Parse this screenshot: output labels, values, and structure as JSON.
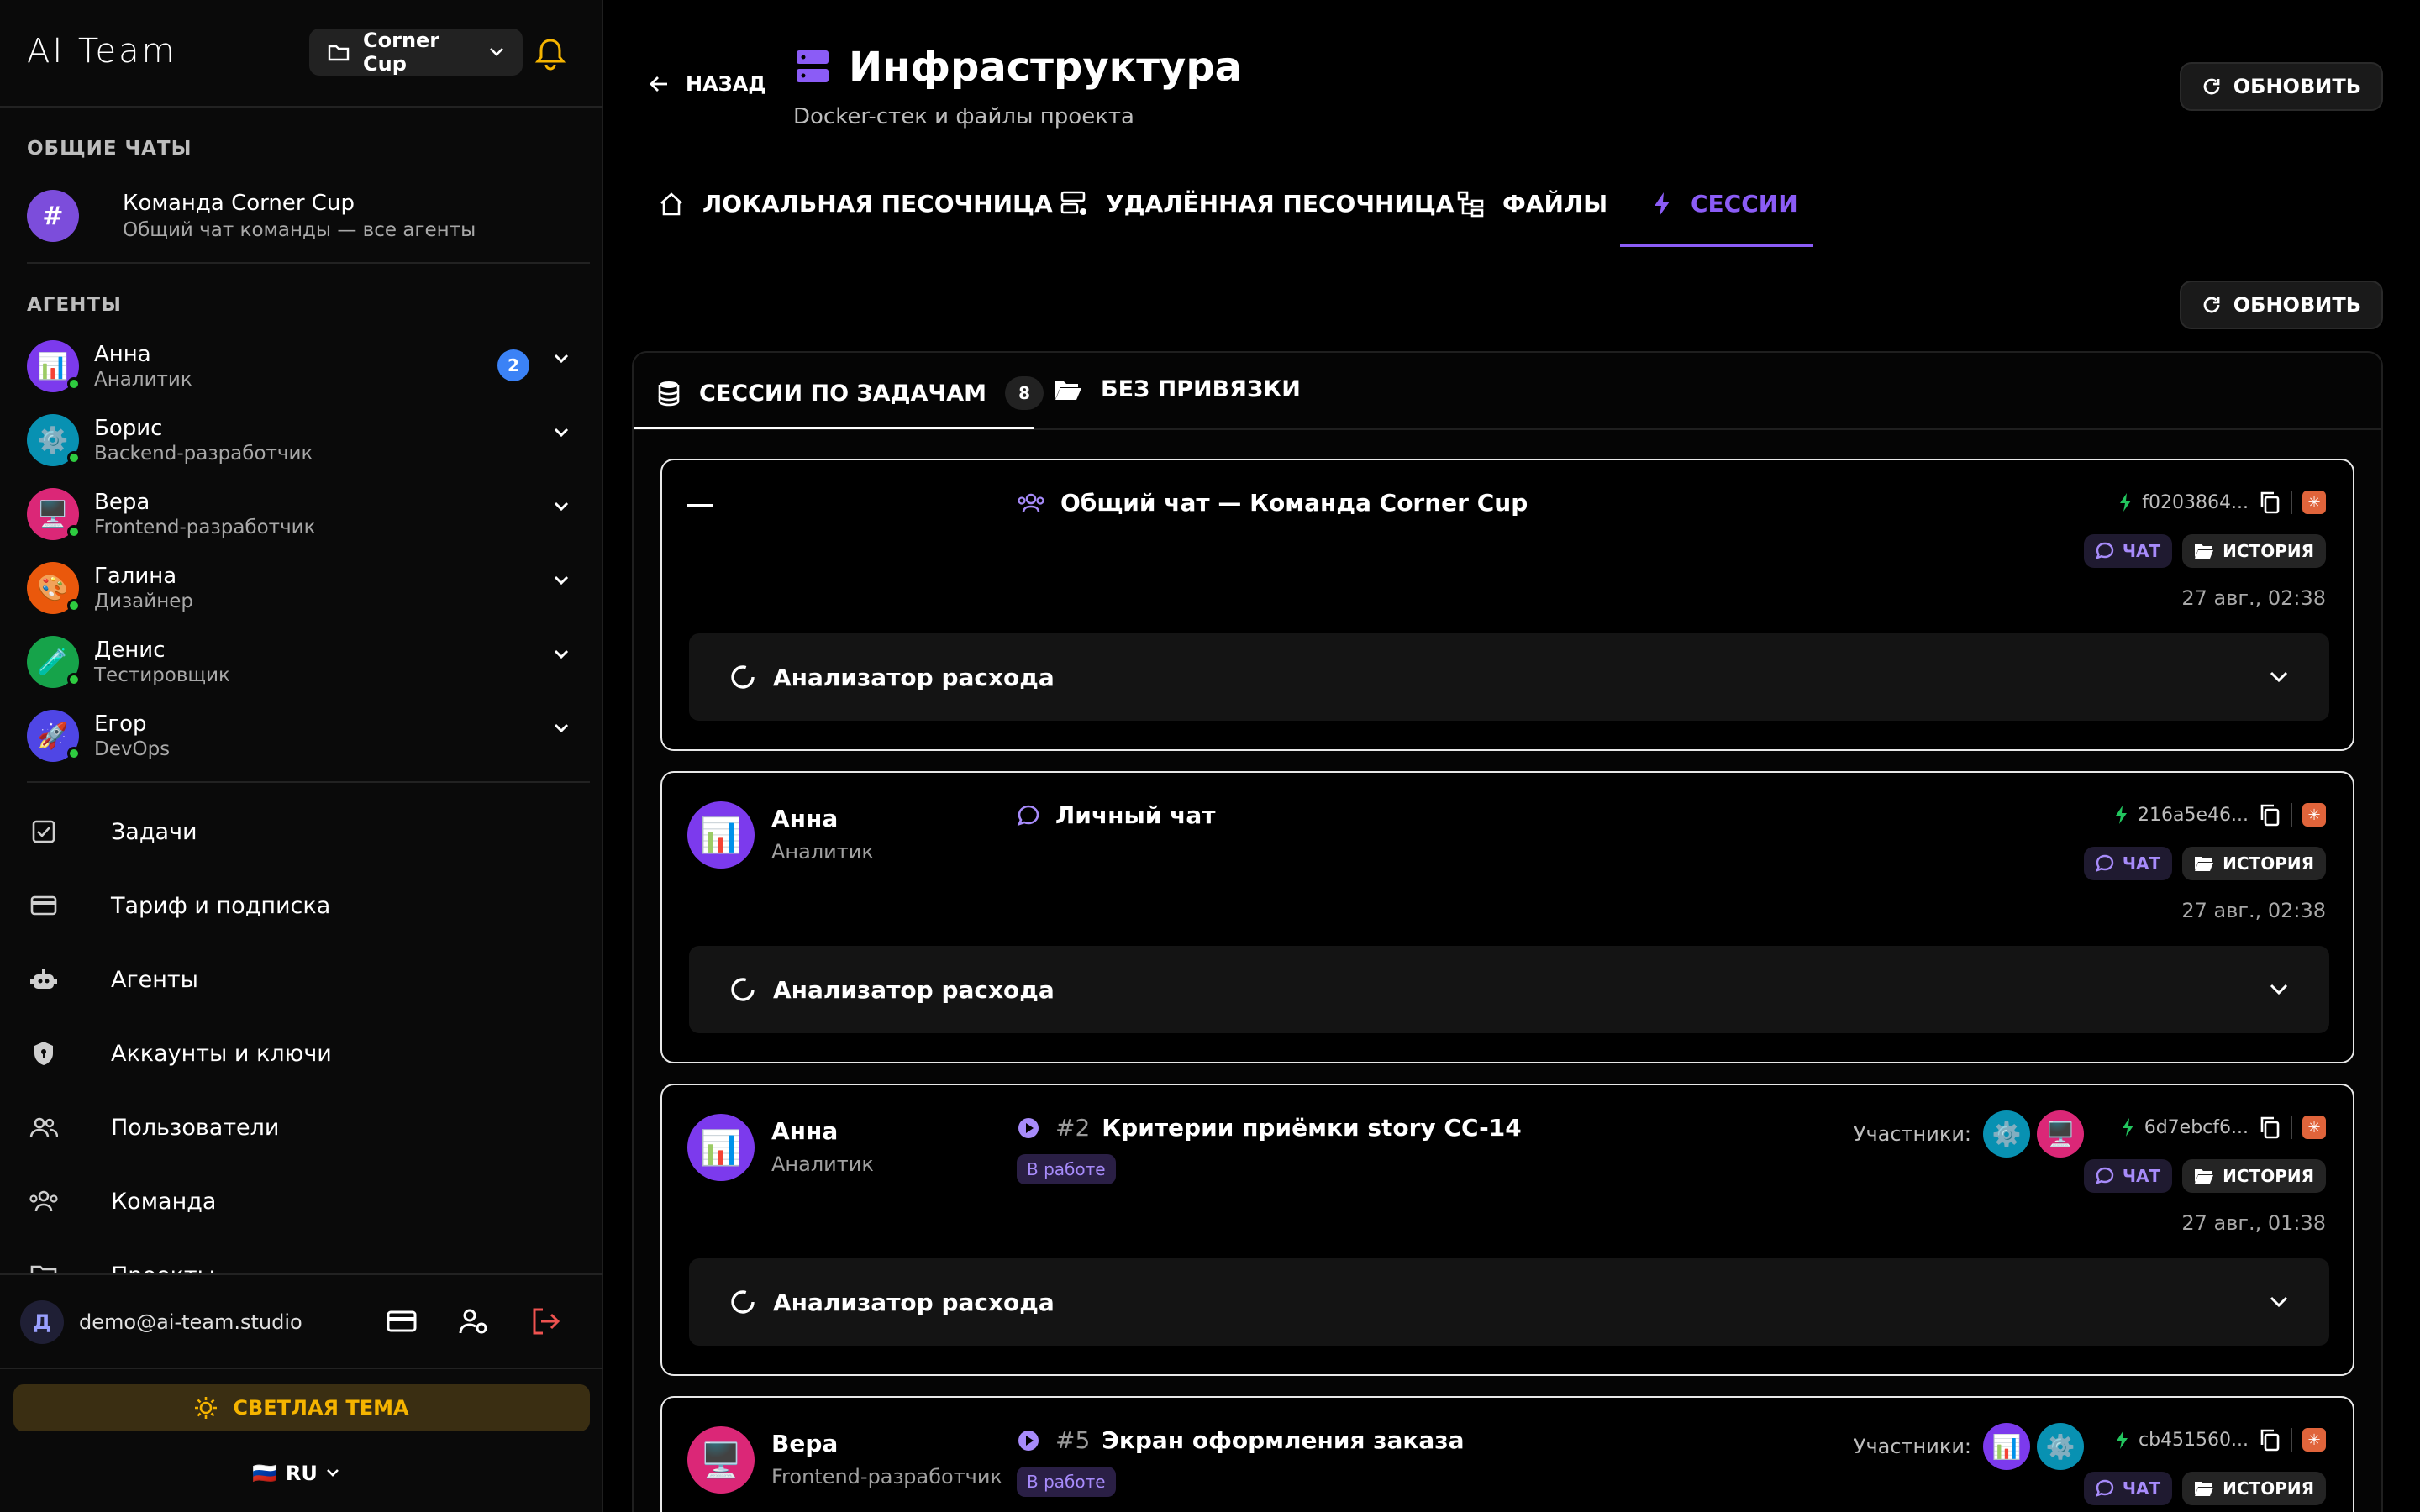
{
  "sidebar": {
    "brand": "AI Team",
    "project": "Corner Cup",
    "shared_title": "ОБЩИЕ ЧАТЫ",
    "team_chat": {
      "name": "Команда Corner Cup",
      "desc": "Общий чат команды — все агенты",
      "avatar": "#"
    },
    "agents_title": "АГЕНТЫ",
    "agents": [
      {
        "name": "Анна",
        "role": "Аналитик",
        "emoji": "📊",
        "color": "#7c3aed",
        "badge": "2"
      },
      {
        "name": "Борис",
        "role": "Backend-разработчик",
        "emoji": "⚙️",
        "color": "#0891b2"
      },
      {
        "name": "Вера",
        "role": "Frontend-разработчик",
        "emoji": "🖥️",
        "color": "#db2777"
      },
      {
        "name": "Галина",
        "role": "Дизайнер",
        "emoji": "🎨",
        "color": "#ea580c"
      },
      {
        "name": "Денис",
        "role": "Тестировщик",
        "emoji": "🧪",
        "color": "#16a34a"
      },
      {
        "name": "Егор",
        "role": "DevOps",
        "emoji": "🚀",
        "color": "#4f46e5"
      }
    ],
    "nav": [
      {
        "label": "Задачи",
        "icon": "checkbox-icon"
      },
      {
        "label": "Тариф и подписка",
        "icon": "credit-card-icon"
      },
      {
        "label": "Агенты",
        "icon": "robot-icon"
      },
      {
        "label": "Аккаунты и ключи",
        "icon": "shield-icon"
      },
      {
        "label": "Пользователи",
        "icon": "users-icon"
      },
      {
        "label": "Команда",
        "icon": "team-icon"
      },
      {
        "label": "Проекты",
        "icon": "folder-icon"
      }
    ],
    "user_initial": "Д",
    "user_email": "demo@ai-team.studio",
    "theme_label": "СВЕТЛАЯ ТЕМА",
    "lang": "RU",
    "lang_flag": "🇷🇺"
  },
  "header": {
    "back_label": "НАЗАД",
    "title": "Инфраструктура",
    "subtitle": "Docker-стек и файлы проекта",
    "refresh_label": "ОБНОВИТЬ"
  },
  "tabs": [
    {
      "label": "ЛОКАЛЬНАЯ ПЕСОЧНИЦА",
      "icon": "home-icon"
    },
    {
      "label": "УДАЛЁННАЯ ПЕСОЧНИЦА",
      "icon": "server-icon"
    },
    {
      "label": "ФАЙЛЫ",
      "icon": "file-tree-icon"
    },
    {
      "label": "СЕССИИ",
      "icon": "bolt-icon"
    }
  ],
  "subtabs": {
    "by_task": "СЕССИИ ПО ЗАДАЧАМ",
    "count": "8",
    "unbound": "БЕЗ ПРИВЯЗКИ"
  },
  "cards": [
    {
      "agent": "—",
      "role": "",
      "title": "Общий чат — Команда Corner Cup",
      "num": "",
      "status": "",
      "sid": "f0203864...",
      "date": "27 авг., 02:38",
      "analyzer": "Анализатор расхода"
    },
    {
      "agent": "Анна",
      "role": "Аналитик",
      "title": "Личный чат",
      "num": "",
      "status": "",
      "sid": "216a5e46...",
      "date": "27 авг., 02:38",
      "analyzer": "Анализатор расхода"
    },
    {
      "agent": "Анна",
      "role": "Аналитик",
      "title": "Критерии приёмки story CC-14",
      "num": "#2",
      "status": "В работе",
      "sid": "6d7ebcf6...",
      "date": "27 авг., 01:38",
      "analyzer": "Анализатор расхода"
    },
    {
      "agent": "Вера",
      "role": "Frontend-разработчик",
      "title": "Экран оформления заказа",
      "num": "#5",
      "status": "В работе",
      "sid": "cb451560...",
      "date": "",
      "analyzer": ""
    }
  ],
  "labels": {
    "participants": "Участники:",
    "chat": "ЧАТ",
    "history": "ИСТОРИЯ"
  }
}
